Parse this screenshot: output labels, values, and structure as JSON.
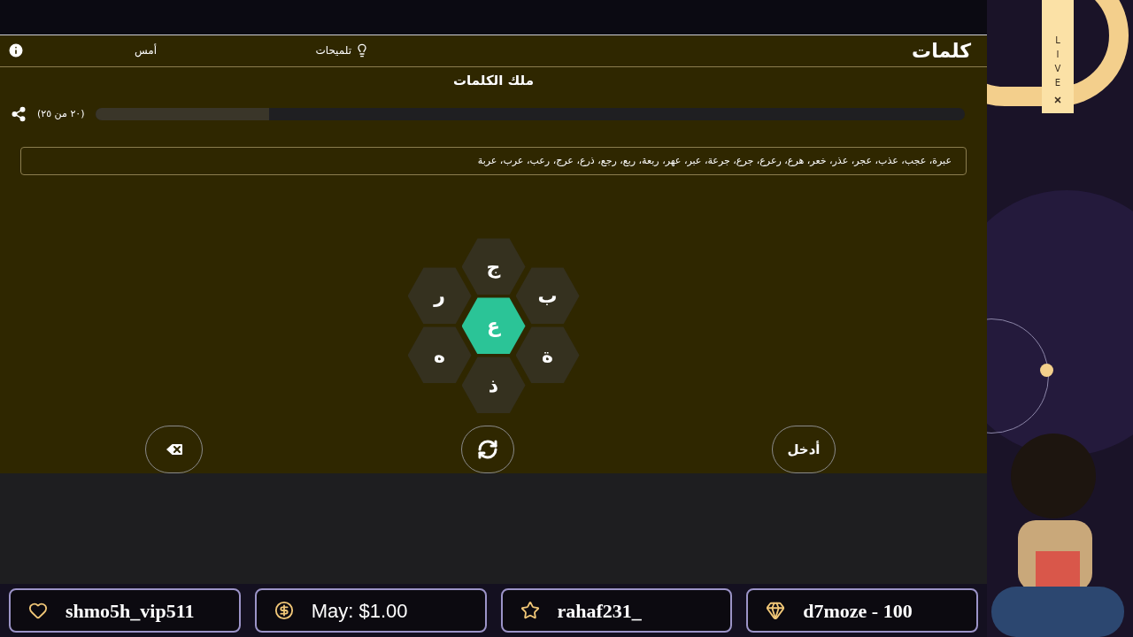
{
  "game": {
    "title": "كلمات",
    "hints": "تلميحات",
    "yesterday": "أمس"
  },
  "puzzle_title": "ملك الكلمات",
  "progress": {
    "level": 0.2,
    "count": "(٢٠ من ٢٥)"
  },
  "found_words": "عبرة، عجب، عذب، عجر، عذر، خعر، هرع، رعرع، جرع، جرعة، عبر، عهر، ربعة، ربع، رجع، ذرع، عرج، رعب، عرب، عربة",
  "letters": [
    {
      "letter": "ج",
      "center": false
    },
    {
      "letter": "ب",
      "center": false
    },
    {
      "letter": "ر",
      "center": false
    },
    {
      "letter": "ع",
      "center": true
    },
    {
      "letter": "ة",
      "center": false
    },
    {
      "letter": "ه",
      "center": false
    },
    {
      "letter": "ذ",
      "center": false
    }
  ],
  "actions": {
    "enter": "أدخل"
  },
  "ribbon": {
    "text": "LIVE"
  },
  "alerts": [
    {
      "kind": "diamond",
      "text": "d7moze - 100"
    },
    {
      "kind": "star",
      "text": "rahaf231_"
    },
    {
      "kind": "dollar",
      "text": "May: $1.00"
    },
    {
      "kind": "heart",
      "text": "shmo5h_vip511"
    }
  ]
}
